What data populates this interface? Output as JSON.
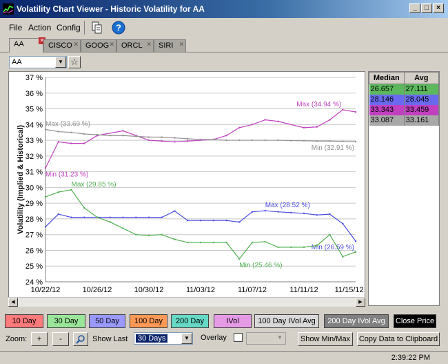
{
  "window": {
    "title": "Volatility Chart Viewer - Historic Volatility for AA"
  },
  "menu": [
    "File",
    "Action",
    "Config"
  ],
  "tabs": [
    {
      "label": "AA",
      "active": true
    },
    {
      "label": "CISCO"
    },
    {
      "label": "GOOG"
    },
    {
      "label": "ORCL"
    },
    {
      "label": "SIRI"
    }
  ],
  "symbol": {
    "value": "AA"
  },
  "side_table": {
    "headers": [
      "Median",
      "Avg"
    ],
    "rows": [
      {
        "median": "26.657",
        "avg": "27.111",
        "color": "#5cb85c"
      },
      {
        "median": "28.146",
        "avg": "28.045",
        "color": "#6a6af0"
      },
      {
        "median": "33.343",
        "avg": "33.459",
        "color": "#c040c0"
      },
      {
        "median": "33.087",
        "avg": "33.161",
        "color": "#a8a8a8"
      }
    ]
  },
  "series_buttons": [
    {
      "label": "10 Day",
      "bg": "#ff7a7a"
    },
    {
      "label": "30 Day",
      "bg": "#99e699"
    },
    {
      "label": "50 Day",
      "bg": "#9999ff"
    },
    {
      "label": "100 Day",
      "bg": "#ff9955"
    },
    {
      "label": "200 Day",
      "bg": "#66d9c6"
    },
    {
      "label": "IVol",
      "bg": "#e69ae6"
    },
    {
      "label": "100 Day IVol Avg",
      "bg": "#d9d9d9"
    },
    {
      "label": "200 Day IVol Avg",
      "bg": "#808080"
    },
    {
      "label": "Close Price",
      "bg": "#000000"
    }
  ],
  "controls": {
    "zoom_label": "Zoom:",
    "zoom_in": "+",
    "zoom_out": "-",
    "show_last_label": "Show Last",
    "show_last_value": "30 Days",
    "overlay_label": "Overlay",
    "show_minmax": "Show Min/Max",
    "copy_data": "Copy Data to Clipboard"
  },
  "status": {
    "time": "2:39:22 PM"
  },
  "chart_data": {
    "type": "line",
    "ylabel": "Volatility (Implied & Historical)",
    "ylim": [
      24,
      37
    ],
    "y_ticks": [
      "24 %",
      "25 %",
      "26 %",
      "27 %",
      "28 %",
      "29 %",
      "30 %",
      "31 %",
      "32 %",
      "33 %",
      "34 %",
      "35 %",
      "36 %",
      "37 %"
    ],
    "x_range": [
      0,
      24
    ],
    "x_ticks": [
      {
        "x": 0,
        "label": "10/22/12"
      },
      {
        "x": 4,
        "label": "10/26/12"
      },
      {
        "x": 8,
        "label": "10/30/12"
      },
      {
        "x": 12,
        "label": "11/03/12"
      },
      {
        "x": 16,
        "label": "11/07/12"
      },
      {
        "x": 20,
        "label": "11/11/12"
      },
      {
        "x": 23.5,
        "label": "11/15/12"
      }
    ],
    "series": [
      {
        "color": "#c040c0",
        "x": [
          0,
          1,
          2,
          3,
          4,
          6,
          7,
          8,
          9,
          10,
          11,
          13,
          14,
          15,
          16,
          17,
          18,
          20,
          21,
          22,
          23,
          24
        ],
        "y": [
          31.23,
          32.9,
          32.8,
          32.8,
          33.3,
          33.6,
          33.3,
          33.0,
          32.95,
          32.9,
          32.95,
          33.05,
          33.3,
          33.8,
          34.0,
          34.3,
          34.2,
          33.8,
          33.85,
          34.3,
          34.94,
          34.8
        ],
        "annotations": [
          {
            "text": "Max (34.94 %)",
            "x": 23,
            "y": 34.94
          },
          {
            "text": "Min (31.23 %)",
            "x": 0,
            "y": 31.23
          }
        ]
      },
      {
        "color": "#909090",
        "x": [
          0,
          1,
          2,
          3,
          4,
          5,
          6,
          7,
          8,
          9,
          10,
          11,
          12,
          13,
          14,
          15,
          16,
          17,
          18,
          19,
          20,
          21,
          22,
          23,
          24
        ],
        "y": [
          33.69,
          33.55,
          33.5,
          33.4,
          33.35,
          33.3,
          33.3,
          33.25,
          33.2,
          33.2,
          33.15,
          33.1,
          33.05,
          33.05,
          33.0,
          33.0,
          33.0,
          33.0,
          33.0,
          32.98,
          32.97,
          32.95,
          32.95,
          32.93,
          32.91
        ],
        "annotations": [
          {
            "text": "Max (33.69 %)",
            "x": 0,
            "y": 33.69
          },
          {
            "text": "Min (32.91 %)",
            "x": 24,
            "y": 32.91
          }
        ]
      },
      {
        "color": "#4a4ae0",
        "x": [
          0,
          1,
          2,
          3,
          4,
          5,
          6,
          7,
          8,
          9,
          10,
          11,
          12,
          13,
          14,
          15,
          16,
          17,
          18,
          19,
          20,
          21,
          22,
          23,
          24
        ],
        "y": [
          27.5,
          28.3,
          28.1,
          28.1,
          28.1,
          28.1,
          28.1,
          28.1,
          28.1,
          28.1,
          28.5,
          27.9,
          27.9,
          27.9,
          27.9,
          27.8,
          28.45,
          28.52,
          28.45,
          28.4,
          28.35,
          28.25,
          28.3,
          27.7,
          26.59
        ],
        "annotations": [
          {
            "text": "Max (28.52 %)",
            "x": 17,
            "y": 28.52
          },
          {
            "text": "Min (26.59 %)",
            "x": 24,
            "y": 26.59
          }
        ]
      },
      {
        "color": "#50b050",
        "x": [
          0,
          1,
          2,
          3,
          4,
          5,
          6,
          7,
          8,
          9,
          10,
          11,
          12,
          13,
          14,
          15,
          16,
          17,
          18,
          19,
          20,
          21,
          22,
          23,
          24
        ],
        "y": [
          29.4,
          29.7,
          29.85,
          28.7,
          28.1,
          27.8,
          27.4,
          27.0,
          26.95,
          27.0,
          26.7,
          26.5,
          26.5,
          26.5,
          26.5,
          25.46,
          26.5,
          26.55,
          26.2,
          26.2,
          26.2,
          26.3,
          27.0,
          25.6,
          25.9
        ],
        "annotations": [
          {
            "text": "Max (29.85 %)",
            "x": 2,
            "y": 29.85
          },
          {
            "text": "Min (25.46 %)",
            "x": 15,
            "y": 25.46
          }
        ]
      }
    ]
  }
}
